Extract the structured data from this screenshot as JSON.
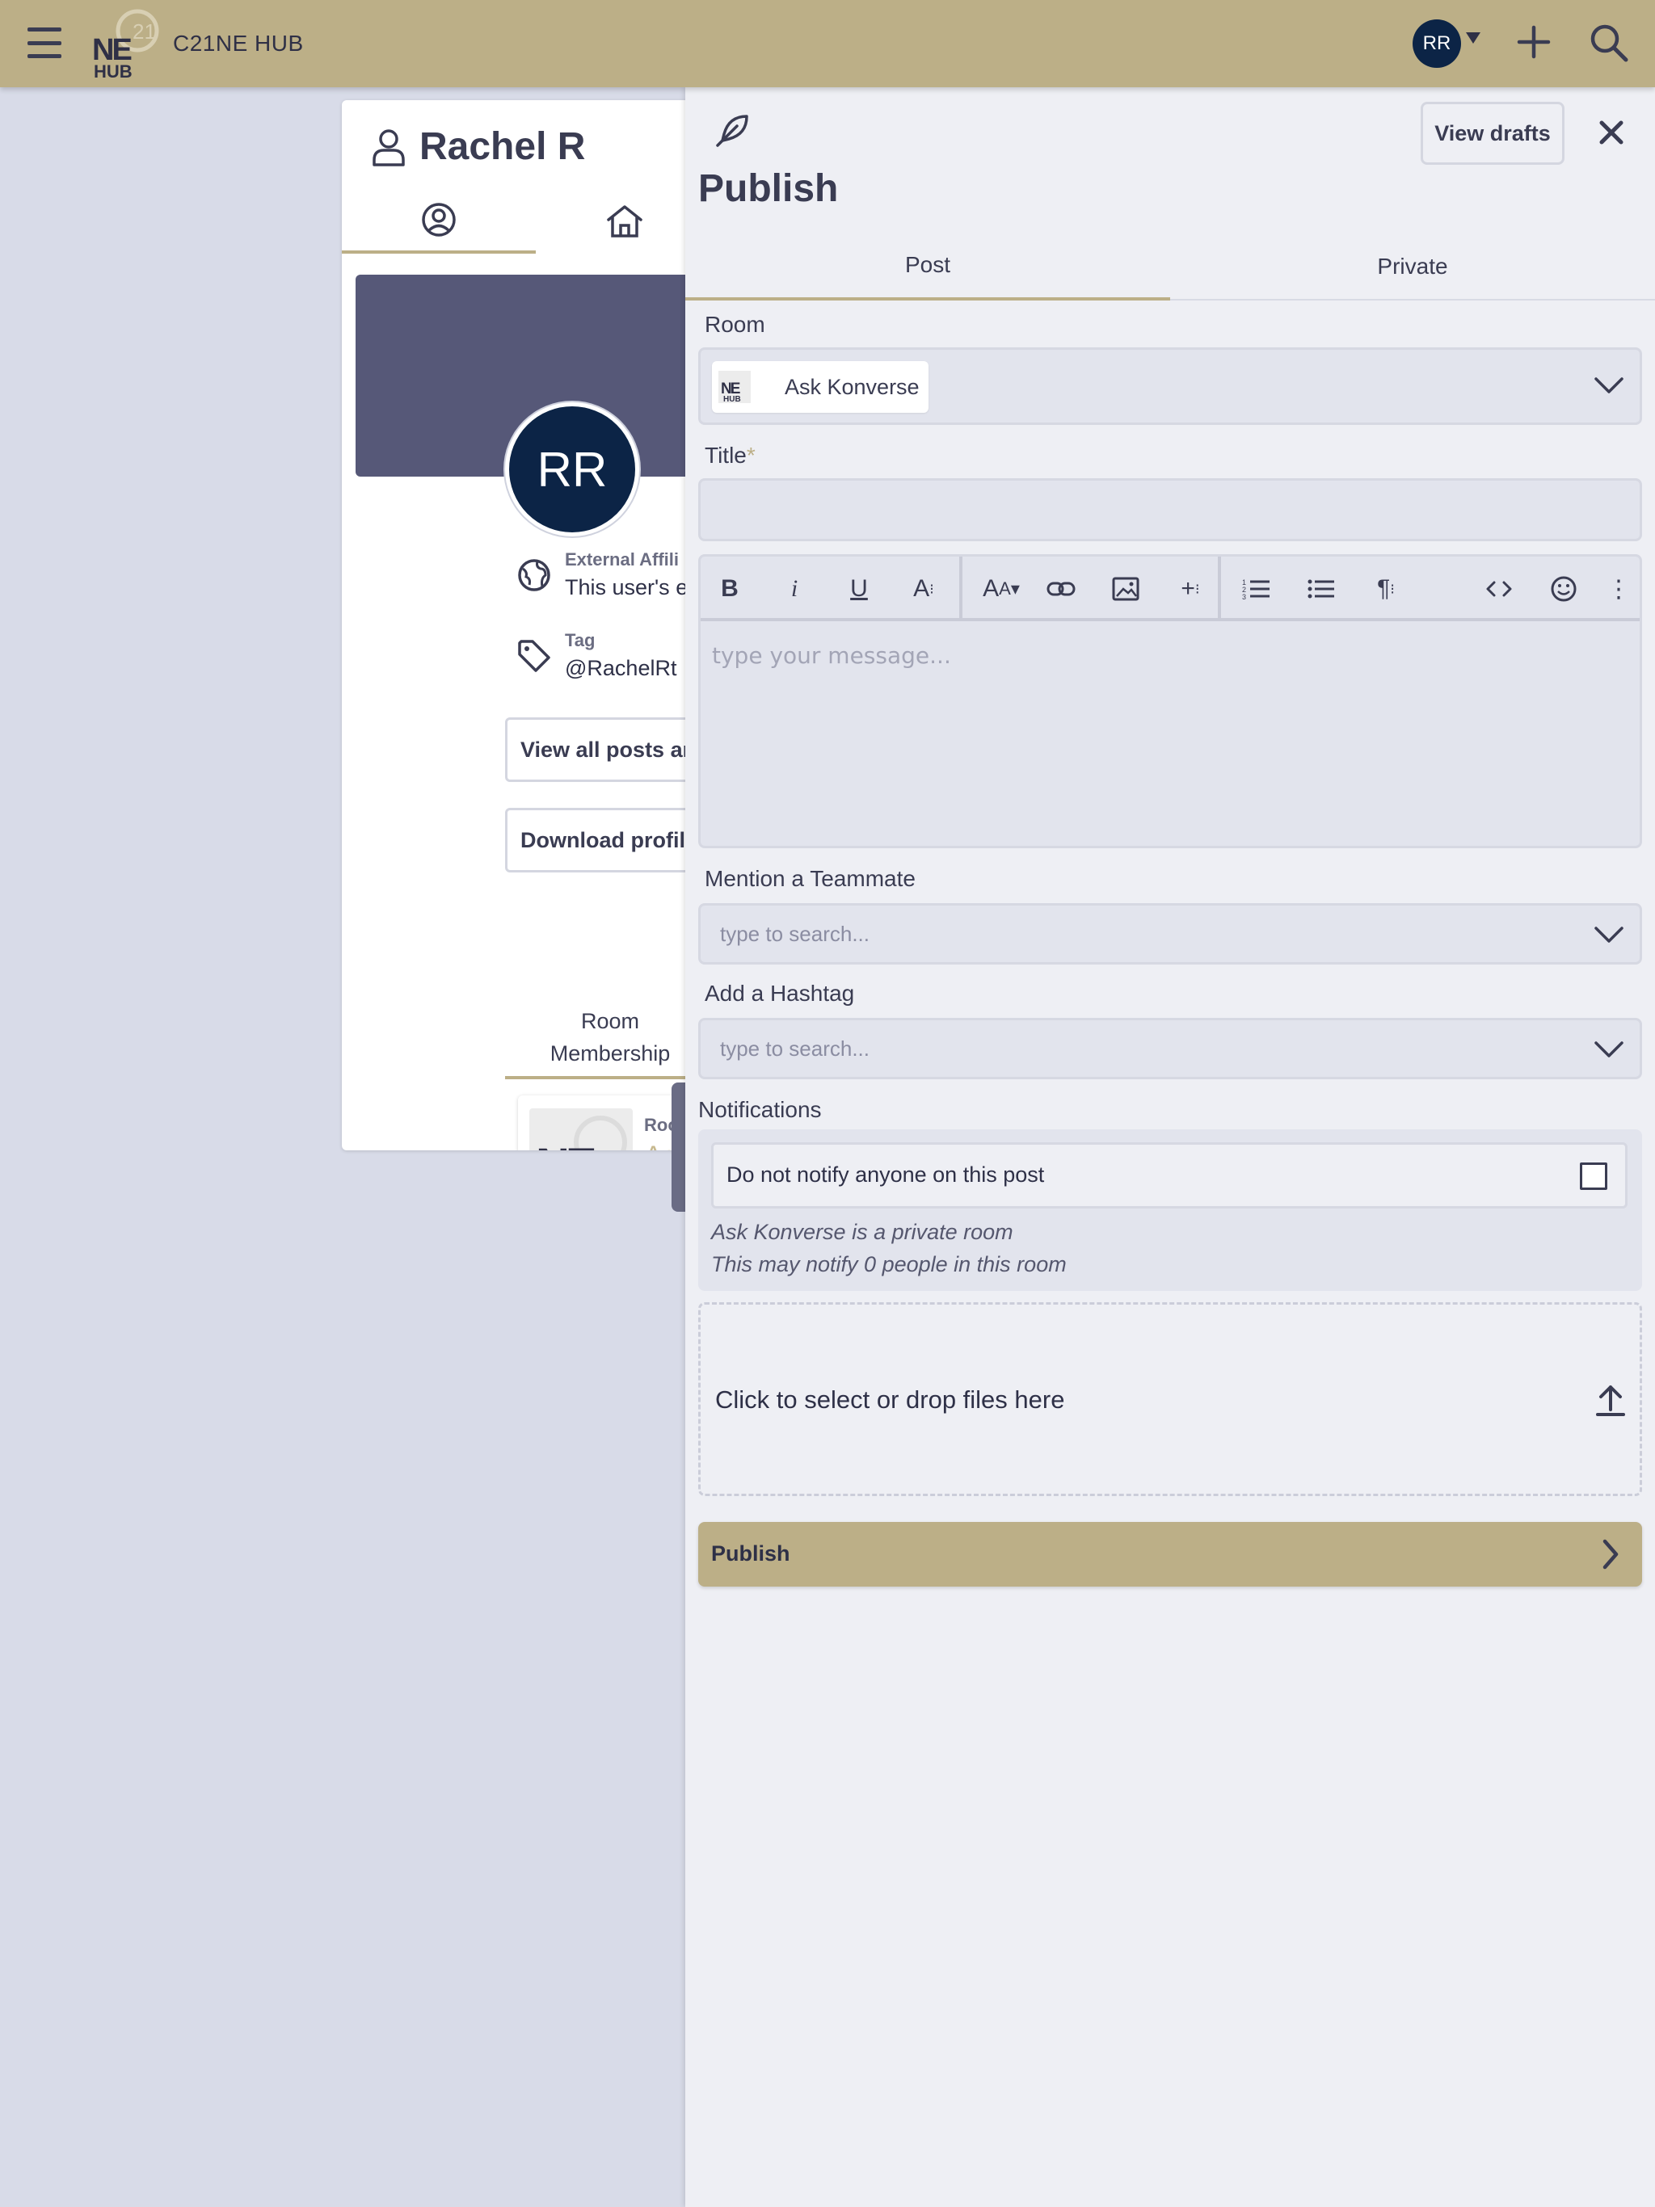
{
  "header": {
    "app_name": "C21NE HUB",
    "logo_text_top": "NE",
    "logo_text_bottom": "HUB",
    "logo_badge": "21",
    "user_initials": "RR",
    "brand_color": "#bcaf87"
  },
  "profile": {
    "name": "Rachel R",
    "avatar_initials": "RR",
    "external_affiliation_label": "External Affili",
    "external_affiliation_value": "This user's e",
    "tag_label": "Tag",
    "tag_value": "@RachelRt",
    "view_posts_button": "View all posts an",
    "download_profile_button": "Download profile",
    "membership_tab_line1": "Room",
    "membership_tab_line2": "Membership",
    "room_card_label": "Roon",
    "room_card_name": "Ask"
  },
  "publish": {
    "title": "Publish",
    "view_drafts_button": "View drafts",
    "tabs": [
      {
        "label": "Post",
        "active": true
      },
      {
        "label": "Private",
        "active": false
      }
    ],
    "room_label": "Room",
    "room_selected": "Ask Konverse",
    "title_label": "Title",
    "title_required_mark": "*",
    "title_value": "",
    "editor_placeholder": "type your message...",
    "toolbar": [
      "bold",
      "italic",
      "underline",
      "font-size",
      "text-case",
      "link",
      "image",
      "insert",
      "ordered-list",
      "bullet-list",
      "paragraph",
      "code",
      "emoji",
      "more"
    ],
    "mention_label": "Mention a Teammate",
    "mention_placeholder": "type to search...",
    "hashtag_label": "Add a Hashtag",
    "hashtag_placeholder": "type to search...",
    "notifications_label": "Notifications",
    "do_not_notify_label": "Do not notify anyone on this post",
    "do_not_notify_checked": false,
    "private_room_note": "Ask Konverse is a private room",
    "notify_count_note": "This may notify 0 people in this room",
    "dropzone_text": "Click to select or drop files here",
    "submit_button": "Publish"
  }
}
